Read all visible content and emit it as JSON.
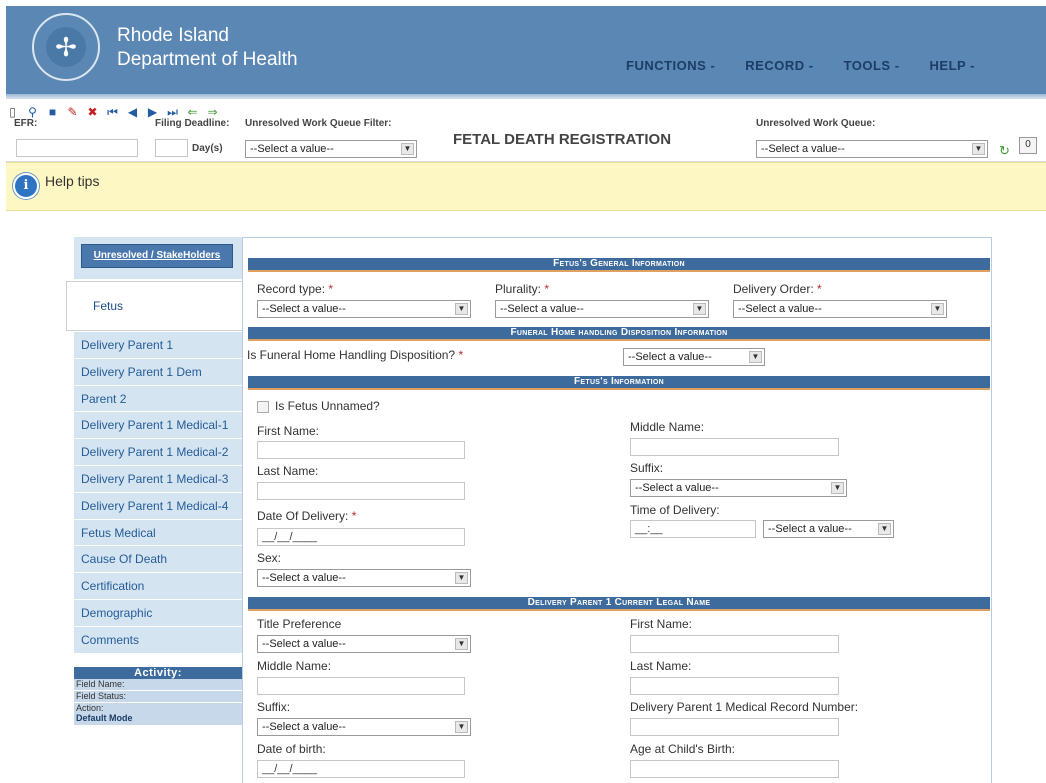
{
  "header": {
    "brand_line1": "Rhode Island",
    "brand_line2": "Department of Health",
    "nav": [
      "FUNCTIONS -",
      "RECORD -",
      "TOOLS -",
      "HELP -"
    ]
  },
  "toolbar": {
    "efr_label": "EFR:",
    "filing_deadline_label": "Filing Deadline:",
    "days_label": "Day(s)",
    "uwq_filter_label": "Unresolved Work Queue Filter:",
    "uwq_filter_value": "--Select a value--",
    "title": "FETAL DEATH REGISTRATION",
    "uwq_label": "Unresolved Work Queue:",
    "uwq_value": "--Select a value--",
    "counter": "0"
  },
  "help": {
    "text": "Help tips"
  },
  "sidebar": {
    "top_button": "Unresolved / StakeHolders",
    "active": "Fetus",
    "items": [
      "Delivery Parent 1",
      "Delivery Parent 1 Dem",
      "Parent 2",
      "Delivery Parent 1 Medical-1",
      "Delivery Parent 1 Medical-2",
      "Delivery Parent 1 Medical-3",
      "Delivery Parent 1 Medical-4",
      "Fetus Medical",
      "Cause Of Death",
      "Certification",
      "Demographic",
      "Comments"
    ],
    "activity": {
      "heading": "Activity:",
      "field_name": "Field Name:",
      "field_status": "Field Status:",
      "action": "Action:",
      "mode": "Default Mode"
    }
  },
  "form": {
    "select_placeholder": "--Select a value--",
    "date_placeholder": "__/__/____",
    "time_placeholder": "__:__",
    "req_mark": "*",
    "general": {
      "heading": "Fetus's General Information",
      "record_type": "Record type:",
      "plurality": "Plurality:",
      "delivery_order": "Delivery Order:"
    },
    "funeral": {
      "heading": "Funeral Home handling Disposition Information",
      "question": "Is Funeral Home Handling Disposition?"
    },
    "fetus_info": {
      "heading": "Fetus's Information",
      "unnamed": "Is Fetus Unnamed?",
      "first_name": "First Name:",
      "middle_name": "Middle Name:",
      "last_name": "Last Name:",
      "suffix": "Suffix:",
      "date_of_delivery": "Date Of Delivery:",
      "time_of_delivery": "Time of Delivery:",
      "sex": "Sex:"
    },
    "parent1": {
      "heading": "Delivery Parent 1 Current Legal Name",
      "title_pref": "Title Preference",
      "first_name": "First Name:",
      "middle_name": "Middle Name:",
      "last_name": "Last Name:",
      "suffix": "Suffix:",
      "mrn": "Delivery Parent 1 Medical Record Number:",
      "dob": "Date of birth:",
      "age": "Age at Child's Birth:"
    }
  }
}
